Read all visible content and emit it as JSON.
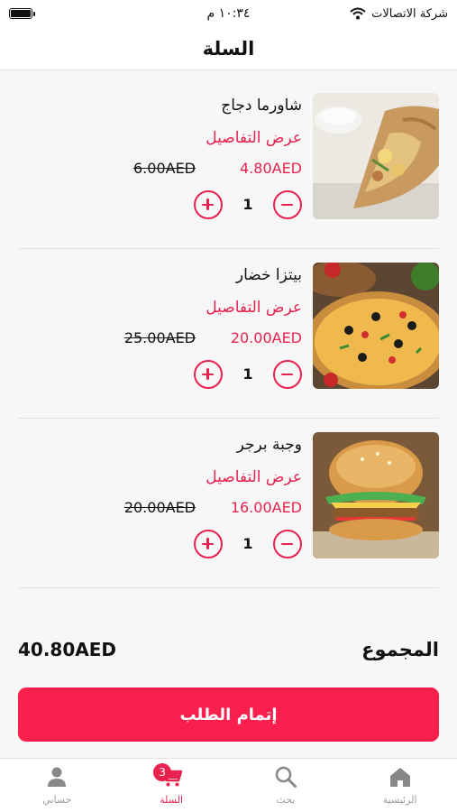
{
  "status_bar": {
    "carrier": "شركة الاتصالات",
    "time": "١٠:٣٤ م"
  },
  "header": {
    "title": "السلة"
  },
  "cart": {
    "items": [
      {
        "name": "شاورما دجاج",
        "details_label": "عرض التفاصيل",
        "price": "4.80AED",
        "old_price": "6.00AED",
        "quantity": "1",
        "image": "shawarma"
      },
      {
        "name": "بيتزا خضار",
        "details_label": "عرض التفاصيل",
        "price": "20.00AED",
        "old_price": "25.00AED",
        "quantity": "1",
        "image": "pizza"
      },
      {
        "name": "وجبة برجر",
        "details_label": "عرض التفاصيل",
        "price": "16.00AED",
        "old_price": "20.00AED",
        "quantity": "1",
        "image": "burger"
      }
    ]
  },
  "summary": {
    "total_label": "المجموع",
    "total_value": "40.80AED"
  },
  "checkout": {
    "label": "إتمام الطلب"
  },
  "tabbar": {
    "tabs": [
      {
        "label": "حسابي",
        "icon": "person-icon"
      },
      {
        "label": "السلة",
        "icon": "cart-icon",
        "badge": "3",
        "active": true
      },
      {
        "label": "بحث",
        "icon": "search-icon"
      },
      {
        "label": "الرئيسية",
        "icon": "home-icon"
      }
    ]
  },
  "colors": {
    "accent": "#e8214f",
    "button": "#fb1f4e",
    "background": "#f7f7f7"
  }
}
